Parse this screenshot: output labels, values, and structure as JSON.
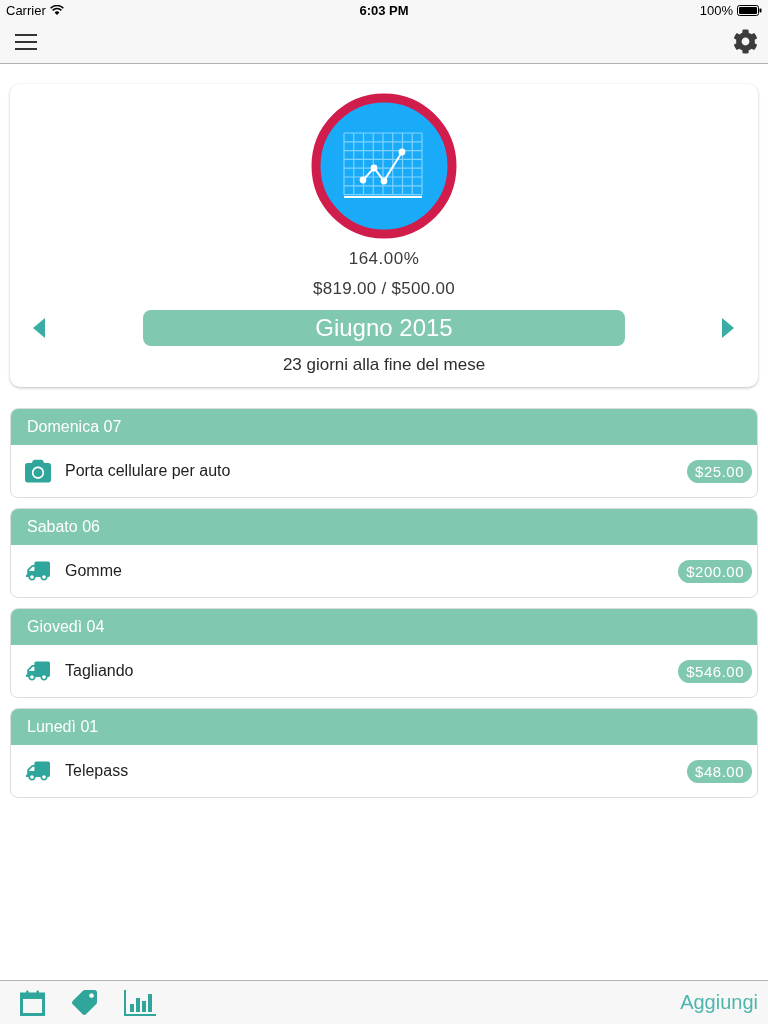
{
  "status_bar": {
    "carrier": "Carrier",
    "time": "6:03 PM",
    "battery": "100%"
  },
  "summary": {
    "percent": "164.00%",
    "amounts": "$819.00 / $500.00",
    "month": "Giugno 2015",
    "days_left": "23 giorni alla fine del mese"
  },
  "days": [
    {
      "title": "Domenica 07",
      "expenses": [
        {
          "kind": "camera",
          "name": "Porta cellulare per auto",
          "amount": "$25.00"
        }
      ]
    },
    {
      "title": "Sabato 06",
      "expenses": [
        {
          "kind": "truck",
          "name": "Gomme",
          "amount": "$200.00"
        }
      ]
    },
    {
      "title": "Giovedì 04",
      "expenses": [
        {
          "kind": "truck",
          "name": "Tagliando",
          "amount": "$546.00"
        }
      ]
    },
    {
      "title": "Lunedì 01",
      "expenses": [
        {
          "kind": "truck",
          "name": "Telepass",
          "amount": "$48.00"
        }
      ]
    }
  ],
  "tab_bar": {
    "action": "Aggiungi"
  }
}
